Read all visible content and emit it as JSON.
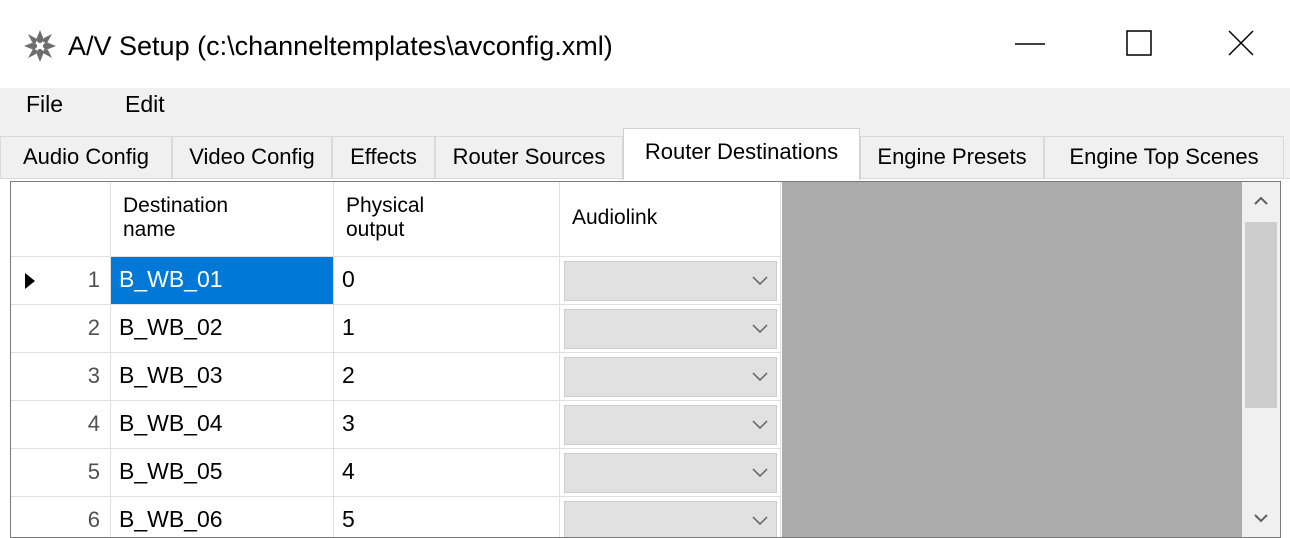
{
  "window": {
    "title": "A/V Setup (c:\\channeltemplates\\avconfig.xml)",
    "icon": "app-icon"
  },
  "menu": {
    "file": "File",
    "edit": "Edit"
  },
  "tabs": [
    {
      "label": "Audio Config",
      "active": false
    },
    {
      "label": "Video Config",
      "active": false
    },
    {
      "label": "Effects",
      "active": false
    },
    {
      "label": "Router Sources",
      "active": false
    },
    {
      "label": "Router Destinations",
      "active": true
    },
    {
      "label": "Engine Presets",
      "active": false
    },
    {
      "label": "Engine Top Scenes",
      "active": false
    }
  ],
  "grid": {
    "columns": {
      "name": "Destination name",
      "output": "Physical output",
      "audiolink": "Audiolink"
    },
    "rows": [
      {
        "num": "1",
        "name": "B_WB_01",
        "output": "0",
        "audiolink": "",
        "current": true,
        "selected": true
      },
      {
        "num": "2",
        "name": "B_WB_02",
        "output": "1",
        "audiolink": ""
      },
      {
        "num": "3",
        "name": "B_WB_03",
        "output": "2",
        "audiolink": ""
      },
      {
        "num": "4",
        "name": "B_WB_04",
        "output": "3",
        "audiolink": ""
      },
      {
        "num": "5",
        "name": "B_WB_05",
        "output": "4",
        "audiolink": ""
      },
      {
        "num": "6",
        "name": "B_WB_06",
        "output": "5",
        "audiolink": ""
      }
    ]
  },
  "colors": {
    "selection": "#0078d7",
    "grid_background": "#ababab",
    "combo_fill": "#e1e1e1"
  }
}
